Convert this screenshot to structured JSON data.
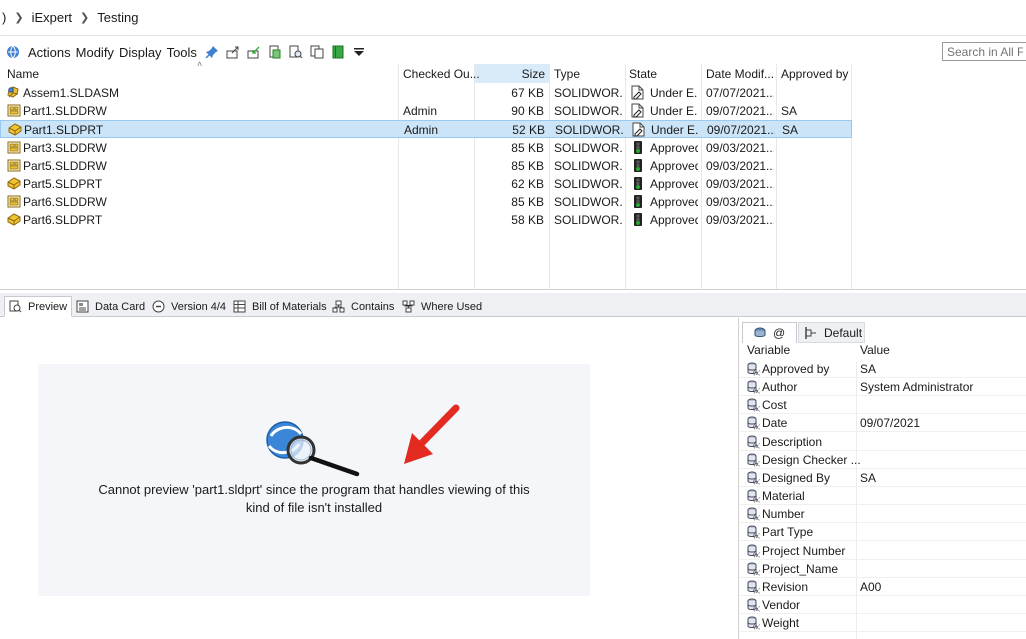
{
  "breadcrumb": {
    "partial": ")",
    "items": [
      "iExpert",
      "Testing"
    ]
  },
  "toolbar": {
    "menus": [
      "Actions",
      "Modify",
      "Display",
      "Tools"
    ],
    "search_placeholder": "Search in All Fol"
  },
  "filelist": {
    "columns": [
      "Name",
      "Checked Ou...",
      "Size",
      "Type",
      "State",
      "Date Modif...",
      "Approved by"
    ],
    "rows": [
      {
        "icon": "assembly-icon",
        "name": "Assem1.SLDASM",
        "checked_out": "",
        "size": "67 KB",
        "type": "SOLIDWOR...",
        "state_icon": "under-editing-icon",
        "state": "Under E...",
        "date": "07/07/2021...",
        "approved_by": ""
      },
      {
        "icon": "drawing-icon",
        "name": "Part1.SLDDRW",
        "checked_out": "Admin",
        "size": "90 KB",
        "type": "SOLIDWOR...",
        "state_icon": "under-editing-icon",
        "state": "Under E...",
        "date": "09/07/2021...",
        "approved_by": "SA"
      },
      {
        "icon": "part-icon",
        "name": "Part1.SLDPRT",
        "checked_out": "Admin",
        "size": "52 KB",
        "type": "SOLIDWOR...",
        "state_icon": "under-editing-icon",
        "state": "Under E...",
        "date": "09/07/2021...",
        "approved_by": "SA",
        "selected": true
      },
      {
        "icon": "drawing-icon",
        "name": "Part3.SLDDRW",
        "checked_out": "",
        "size": "85 KB",
        "type": "SOLIDWOR...",
        "state_icon": "approved-icon",
        "state": "Approved",
        "date": "09/03/2021...",
        "approved_by": ""
      },
      {
        "icon": "drawing-icon",
        "name": "Part5.SLDDRW",
        "checked_out": "",
        "size": "85 KB",
        "type": "SOLIDWOR...",
        "state_icon": "approved-icon",
        "state": "Approved",
        "date": "09/03/2021...",
        "approved_by": ""
      },
      {
        "icon": "part-icon",
        "name": "Part5.SLDPRT",
        "checked_out": "",
        "size": "62 KB",
        "type": "SOLIDWOR...",
        "state_icon": "approved-icon",
        "state": "Approved",
        "date": "09/03/2021...",
        "approved_by": ""
      },
      {
        "icon": "drawing-icon",
        "name": "Part6.SLDDRW",
        "checked_out": "",
        "size": "85 KB",
        "type": "SOLIDWOR...",
        "state_icon": "approved-icon",
        "state": "Approved",
        "date": "09/03/2021...",
        "approved_by": ""
      },
      {
        "icon": "part-icon",
        "name": "Part6.SLDPRT",
        "checked_out": "",
        "size": "58 KB",
        "type": "SOLIDWOR...",
        "state_icon": "approved-icon",
        "state": "Approved",
        "date": "09/03/2021...",
        "approved_by": ""
      }
    ]
  },
  "tabs": [
    {
      "label": "Preview",
      "icon": "preview-icon",
      "active": true
    },
    {
      "label": "Data Card",
      "icon": "data-card-icon"
    },
    {
      "label": "Version 4/4",
      "icon": "version-icon"
    },
    {
      "label": "Bill of Materials",
      "icon": "bom-icon"
    },
    {
      "label": "Contains",
      "icon": "contains-icon"
    },
    {
      "label": "Where Used",
      "icon": "where-used-icon"
    }
  ],
  "preview": {
    "message_line1": "Cannot preview 'part1.sldprt' since the program that handles viewing of this",
    "message_line2": "kind of file isn't installed"
  },
  "variables": {
    "tab_at": "@",
    "tab_default": "Default",
    "header_variable": "Variable",
    "header_value": "Value",
    "rows": [
      {
        "name": "Approved by",
        "value": "SA"
      },
      {
        "name": "Author",
        "value": "System Administrator"
      },
      {
        "name": "Cost",
        "value": ""
      },
      {
        "name": "Date",
        "value": "09/07/2021"
      },
      {
        "name": "Description",
        "value": ""
      },
      {
        "name": "Design Checker ...",
        "value": ""
      },
      {
        "name": "Designed By",
        "value": "SA"
      },
      {
        "name": "Material",
        "value": ""
      },
      {
        "name": "Number",
        "value": ""
      },
      {
        "name": "Part Type",
        "value": ""
      },
      {
        "name": "Project Number",
        "value": ""
      },
      {
        "name": "Project_Name",
        "value": ""
      },
      {
        "name": "Revision",
        "value": "A00"
      },
      {
        "name": "Vendor",
        "value": ""
      },
      {
        "name": "Weight",
        "value": ""
      }
    ]
  },
  "colors": {
    "selection": "#cce4f7",
    "annotation_arrow": "#e32b22",
    "approved_green": "#2aa836"
  }
}
